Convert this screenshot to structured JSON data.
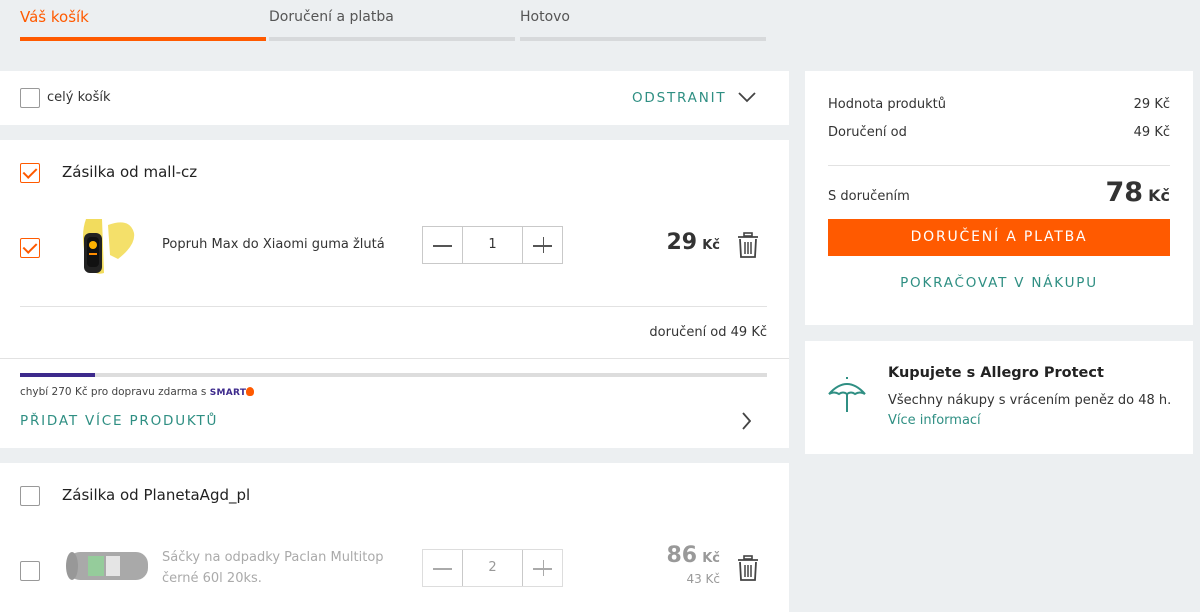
{
  "steps": [
    {
      "label": "Váš košík"
    },
    {
      "label": "Doručení a platba"
    },
    {
      "label": "Hotovo"
    }
  ],
  "cart_toolbar": {
    "select_all_label": "celý košík",
    "remove_label": "ODSTRANIT"
  },
  "shipment1": {
    "title": "Zásilka od mall-cz",
    "item": {
      "name": "Popruh Max do Xiaomi guma žlutá",
      "quantity": "1",
      "price": "29",
      "currency": "Kč"
    },
    "delivery": "doručení od 49 Kč",
    "free_shipping_note": "chybí 270 Kč pro dopravu zdarma s",
    "smart_logo": "SMART",
    "free_shipping_progress": 0.1,
    "add_more_label": "PŘIDAT VÍCE PRODUKTŮ"
  },
  "shipment2": {
    "title": "Zásilka od PlanetaAgd_pl",
    "item": {
      "name_line1": "Sáčky na odpadky Paclan Multitop",
      "name_line2": "černé 60l 20ks.",
      "quantity": "2",
      "price": "86",
      "currency": "Kč",
      "unit_price": "43 Kč"
    }
  },
  "summary": {
    "products_label": "Hodnota produktů",
    "products_value": "29 Kč",
    "delivery_label": "Doručení od",
    "delivery_value": "49 Kč",
    "total_label": "S doručením",
    "total_value": "78",
    "total_currency": "Kč",
    "checkout_label": "DORUČENÍ A PLATBA",
    "continue_label": "POKRAČOVAT V NÁKUPU"
  },
  "protect": {
    "title": "Kupujete s Allegro Protect",
    "text": "Všechny nákupy s vrácením peněz do 48 h.",
    "link": "Více informací"
  },
  "colors": {
    "accent": "#ff5a00",
    "teal": "#2f8f83",
    "progress": "#3d2a8c",
    "background": "#eceff1"
  }
}
